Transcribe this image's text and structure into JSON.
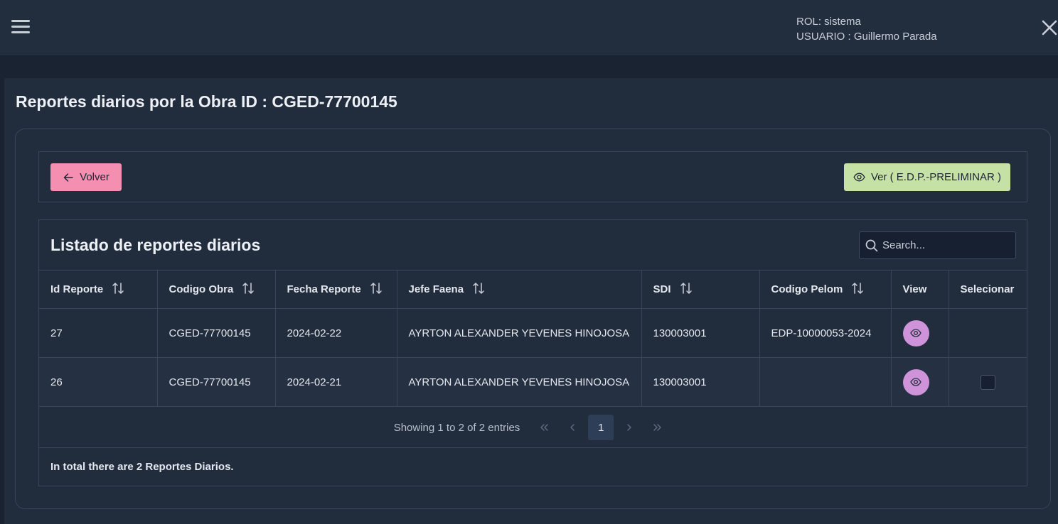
{
  "topbar": {
    "role": "ROL: sistema",
    "user": "USUARIO : Guillermo Parada"
  },
  "page": {
    "title": "Reportes diarios por la Obra ID : CGED-77700145"
  },
  "toolbar": {
    "back_label": "Volver",
    "preview_label": "Ver ( E.D.P.-PRELIMINAR )"
  },
  "table": {
    "title": "Listado de reportes diarios",
    "search_placeholder": "Search...",
    "columns": [
      "Id Reporte",
      "Codigo Obra",
      "Fecha Reporte",
      "Jefe Faena",
      "SDI",
      "Codigo Pelom",
      "View",
      "Selecionar"
    ],
    "rows": [
      {
        "id": "27",
        "obra": "CGED-77700145",
        "fecha": "2024-02-22",
        "jefe": "AYRTON ALEXANDER YEVENES HINOJOSA",
        "sdi": "130003001",
        "pelom": "EDP-10000053-2024",
        "has_checkbox": false
      },
      {
        "id": "26",
        "obra": "CGED-77700145",
        "fecha": "2024-02-21",
        "jefe": "AYRTON ALEXANDER YEVENES HINOJOSA",
        "sdi": "130003001",
        "pelom": "",
        "has_checkbox": true
      }
    ]
  },
  "paginator": {
    "report": "Showing 1 to 2 of 2 entries",
    "current_page": "1"
  },
  "footer": {
    "summary": "In total there are 2 Reportes Diarios."
  },
  "colors": {
    "background": "#1a2332",
    "panel": "#212c3d",
    "back_button": "#f48fb1",
    "preview_button": "#c5e1a5",
    "view_button": "#ce93d8"
  }
}
